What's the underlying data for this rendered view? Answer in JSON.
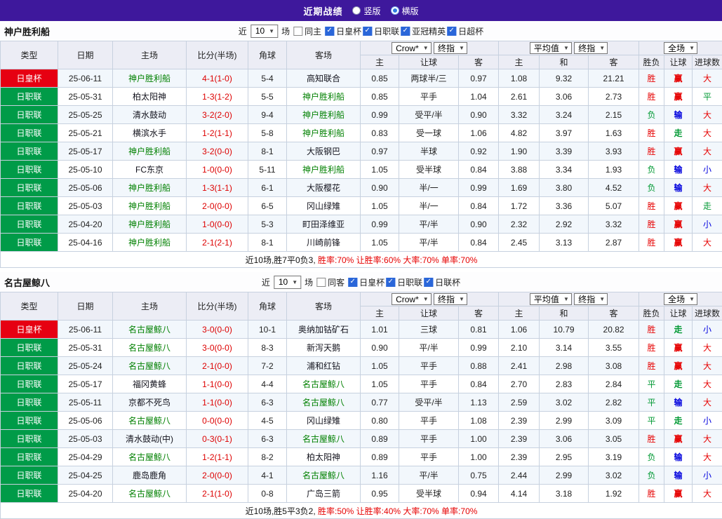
{
  "topbar": {
    "title": "近期战绩",
    "radio_vertical": "竖版",
    "radio_horizontal": "横版",
    "selected_layout": "横版"
  },
  "colors": {
    "topbar_bg": "#3e189c",
    "cup_red": "#e60012",
    "league_green": "#009b48",
    "focal_team_green": "#008000",
    "score_red": "#dd0000",
    "result_red": "#e60000",
    "result_green": "#009933",
    "result_blue": "#0000dd",
    "header_bg": "#ecedf5",
    "row_alt_bg": "#f2f7fc"
  },
  "type_styles": {
    "日皇杯": "cup",
    "日职联": "league"
  },
  "result_colors": {
    "胜": "red",
    "负": "green",
    "平": "green",
    "赢": "red",
    "输": "blue",
    "走": "green",
    "大": "red",
    "小": "blue"
  },
  "sections": [
    {
      "team": "神户胜利船",
      "filters": {
        "recent_prefix": "近",
        "recent_value": "10",
        "recent_suffix": "场",
        "same_label": "同主",
        "same_checked": false,
        "leagues": [
          {
            "label": "日皇杯",
            "checked": true
          },
          {
            "label": "日职联",
            "checked": true
          },
          {
            "label": "亚冠精英",
            "checked": true
          },
          {
            "label": "日超杯",
            "checked": true
          }
        ]
      },
      "header": {
        "type": "类型",
        "date": "日期",
        "home": "主场",
        "score": "比分(半场)",
        "corner": "角球",
        "away": "客场",
        "group1": {
          "select1": "Crow*",
          "select2": "终指",
          "cols": [
            "主",
            "让球",
            "客"
          ]
        },
        "group2": {
          "select1": "平均值",
          "select2": "终指",
          "cols": [
            "主",
            "和",
            "客"
          ]
        },
        "group3": {
          "select": "全场",
          "cols": [
            "胜负",
            "让球",
            "进球数"
          ]
        }
      },
      "rows": [
        {
          "type": "日皇杯",
          "date": "25-06-11",
          "home": "神户胜利船",
          "score": "4-1(1-0)",
          "corner": "5-4",
          "away": "高知联合",
          "odds": [
            "0.85",
            "两球半/三",
            "0.97"
          ],
          "avg": [
            "1.08",
            "9.32",
            "21.21"
          ],
          "results": [
            "胜",
            "赢",
            "大"
          ]
        },
        {
          "type": "日职联",
          "date": "25-05-31",
          "home": "柏太阳神",
          "score": "1-3(1-2)",
          "corner": "5-5",
          "away": "神户胜利船",
          "odds": [
            "0.85",
            "平手",
            "1.04"
          ],
          "avg": [
            "2.61",
            "3.06",
            "2.73"
          ],
          "results": [
            "胜",
            "赢",
            "平"
          ]
        },
        {
          "type": "日职联",
          "date": "25-05-25",
          "home": "清水鼓动",
          "score": "3-2(2-0)",
          "corner": "9-4",
          "away": "神户胜利船",
          "odds": [
            "0.99",
            "受平/半",
            "0.90"
          ],
          "avg": [
            "3.32",
            "3.24",
            "2.15"
          ],
          "results": [
            "负",
            "输",
            "大"
          ]
        },
        {
          "type": "日职联",
          "date": "25-05-21",
          "home": "横滨水手",
          "score": "1-2(1-1)",
          "corner": "5-8",
          "away": "神户胜利船",
          "odds": [
            "0.83",
            "受一球",
            "1.06"
          ],
          "avg": [
            "4.82",
            "3.97",
            "1.63"
          ],
          "results": [
            "胜",
            "走",
            "大"
          ]
        },
        {
          "type": "日职联",
          "date": "25-05-17",
          "home": "神户胜利船",
          "score": "3-2(0-0)",
          "corner": "8-1",
          "away": "大阪钢巴",
          "odds": [
            "0.97",
            "半球",
            "0.92"
          ],
          "avg": [
            "1.90",
            "3.39",
            "3.93"
          ],
          "results": [
            "胜",
            "赢",
            "大"
          ]
        },
        {
          "type": "日职联",
          "date": "25-05-10",
          "home": "FC东京",
          "score": "1-0(0-0)",
          "corner": "5-11",
          "away": "神户胜利船",
          "odds": [
            "1.05",
            "受半球",
            "0.84"
          ],
          "avg": [
            "3.88",
            "3.34",
            "1.93"
          ],
          "results": [
            "负",
            "输",
            "小"
          ]
        },
        {
          "type": "日职联",
          "date": "25-05-06",
          "home": "神户胜利船",
          "score": "1-3(1-1)",
          "corner": "6-1",
          "away": "大阪樱花",
          "odds": [
            "0.90",
            "半/一",
            "0.99"
          ],
          "avg": [
            "1.69",
            "3.80",
            "4.52"
          ],
          "results": [
            "负",
            "输",
            "大"
          ]
        },
        {
          "type": "日职联",
          "date": "25-05-03",
          "home": "神户胜利船",
          "score": "2-0(0-0)",
          "corner": "6-5",
          "away": "冈山绿雉",
          "odds": [
            "1.05",
            "半/一",
            "0.84"
          ],
          "avg": [
            "1.72",
            "3.36",
            "5.07"
          ],
          "results": [
            "胜",
            "赢",
            "走"
          ]
        },
        {
          "type": "日职联",
          "date": "25-04-20",
          "home": "神户胜利船",
          "score": "1-0(0-0)",
          "corner": "5-3",
          "away": "町田泽维亚",
          "odds": [
            "0.99",
            "平/半",
            "0.90"
          ],
          "avg": [
            "2.32",
            "2.92",
            "3.32"
          ],
          "results": [
            "胜",
            "赢",
            "小"
          ]
        },
        {
          "type": "日职联",
          "date": "25-04-16",
          "home": "神户胜利船",
          "score": "2-1(2-1)",
          "corner": "8-1",
          "away": "川崎前锋",
          "odds": [
            "1.05",
            "平/半",
            "0.84"
          ],
          "avg": [
            "2.45",
            "3.13",
            "2.87"
          ],
          "results": [
            "胜",
            "赢",
            "大"
          ]
        }
      ],
      "summary": {
        "record": "近10场,胜7平0负3,",
        "rates": "胜率:70% 让胜率:60% 大率:70% 单率:70%"
      }
    },
    {
      "team": "名古屋鲸八",
      "filters": {
        "recent_prefix": "近",
        "recent_value": "10",
        "recent_suffix": "场",
        "same_label": "同客",
        "same_checked": false,
        "leagues": [
          {
            "label": "日皇杯",
            "checked": true
          },
          {
            "label": "日职联",
            "checked": true
          },
          {
            "label": "日联杯",
            "checked": true
          }
        ]
      },
      "header": {
        "type": "类型",
        "date": "日期",
        "home": "主场",
        "score": "比分(半场)",
        "corner": "角球",
        "away": "客场",
        "group1": {
          "select1": "Crow*",
          "select2": "终指",
          "cols": [
            "主",
            "让球",
            "客"
          ]
        },
        "group2": {
          "select1": "平均值",
          "select2": "终指",
          "cols": [
            "主",
            "和",
            "客"
          ]
        },
        "group3": {
          "select": "全场",
          "cols": [
            "胜负",
            "让球",
            "进球数"
          ]
        }
      },
      "rows": [
        {
          "type": "日皇杯",
          "date": "25-06-11",
          "home": "名古屋鲸八",
          "score": "3-0(0-0)",
          "corner": "10-1",
          "away": "奥纳加钴矿石",
          "odds": [
            "1.01",
            "三球",
            "0.81"
          ],
          "avg": [
            "1.06",
            "10.79",
            "20.82"
          ],
          "results": [
            "胜",
            "走",
            "小"
          ]
        },
        {
          "type": "日职联",
          "date": "25-05-31",
          "home": "名古屋鲸八",
          "score": "3-0(0-0)",
          "corner": "8-3",
          "away": "新泻天鹅",
          "odds": [
            "0.90",
            "平/半",
            "0.99"
          ],
          "avg": [
            "2.10",
            "3.14",
            "3.55"
          ],
          "results": [
            "胜",
            "赢",
            "大"
          ]
        },
        {
          "type": "日职联",
          "date": "25-05-24",
          "home": "名古屋鲸八",
          "score": "2-1(0-0)",
          "corner": "7-2",
          "away": "浦和红钻",
          "odds": [
            "1.05",
            "平手",
            "0.88"
          ],
          "avg": [
            "2.41",
            "2.98",
            "3.08"
          ],
          "results": [
            "胜",
            "赢",
            "大"
          ]
        },
        {
          "type": "日职联",
          "date": "25-05-17",
          "home": "福冈黄蜂",
          "score": "1-1(0-0)",
          "corner": "4-4",
          "away": "名古屋鲸八",
          "odds": [
            "1.05",
            "平手",
            "0.84"
          ],
          "avg": [
            "2.70",
            "2.83",
            "2.84"
          ],
          "results": [
            "平",
            "走",
            "大"
          ]
        },
        {
          "type": "日职联",
          "date": "25-05-11",
          "home": "京都不死鸟",
          "score": "1-1(0-0)",
          "corner": "6-3",
          "away": "名古屋鲸八",
          "odds": [
            "0.77",
            "受平/半",
            "1.13"
          ],
          "avg": [
            "2.59",
            "3.02",
            "2.82"
          ],
          "results": [
            "平",
            "输",
            "大"
          ]
        },
        {
          "type": "日职联",
          "date": "25-05-06",
          "home": "名古屋鲸八",
          "score": "0-0(0-0)",
          "corner": "4-5",
          "away": "冈山绿雉",
          "odds": [
            "0.80",
            "平手",
            "1.08"
          ],
          "avg": [
            "2.39",
            "2.99",
            "3.09"
          ],
          "results": [
            "平",
            "走",
            "小"
          ]
        },
        {
          "type": "日职联",
          "date": "25-05-03",
          "home": "清水鼓动(中)",
          "score": "0-3(0-1)",
          "corner": "6-3",
          "away": "名古屋鲸八",
          "odds": [
            "0.89",
            "平手",
            "1.00"
          ],
          "avg": [
            "2.39",
            "3.06",
            "3.05"
          ],
          "results": [
            "胜",
            "赢",
            "大"
          ]
        },
        {
          "type": "日职联",
          "date": "25-04-29",
          "home": "名古屋鲸八",
          "score": "1-2(1-1)",
          "corner": "8-2",
          "away": "柏太阳神",
          "odds": [
            "0.89",
            "平手",
            "1.00"
          ],
          "avg": [
            "2.39",
            "2.95",
            "3.19"
          ],
          "results": [
            "负",
            "输",
            "大"
          ]
        },
        {
          "type": "日职联",
          "date": "25-04-25",
          "home": "鹿岛鹿角",
          "score": "2-0(0-0)",
          "corner": "4-1",
          "away": "名古屋鲸八",
          "odds": [
            "1.16",
            "平/半",
            "0.75"
          ],
          "avg": [
            "2.44",
            "2.99",
            "3.02"
          ],
          "results": [
            "负",
            "输",
            "小"
          ]
        },
        {
          "type": "日职联",
          "date": "25-04-20",
          "home": "名古屋鲸八",
          "score": "2-1(1-0)",
          "corner": "0-8",
          "away": "广岛三箭",
          "odds": [
            "0.95",
            "受半球",
            "0.94"
          ],
          "avg": [
            "4.14",
            "3.18",
            "1.92"
          ],
          "results": [
            "胜",
            "赢",
            "大"
          ]
        }
      ],
      "summary": {
        "record": "近10场,胜5平3负2,",
        "rates": "胜率:50% 让胜率:40% 大率:70% 单率:70%"
      }
    }
  ]
}
